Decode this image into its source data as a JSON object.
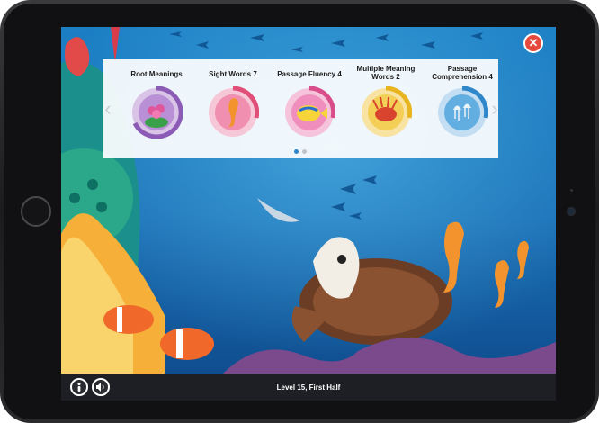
{
  "app": {
    "close_icon": "close-icon"
  },
  "levels": [
    {
      "title": "Root Meanings",
      "icon": "sea-anemone-icon",
      "ring_color": "#8b5bb5",
      "progress": 0.45,
      "bg": "#b98fd6"
    },
    {
      "title": "Sight Words 7",
      "icon": "seahorse-icon",
      "ring_color": "#e04f78",
      "progress": 0.3,
      "bg": "#f08fb0"
    },
    {
      "title": "Passage Fluency 4",
      "icon": "tropical-fish-icon",
      "ring_color": "#d84d8a",
      "progress": 0.3,
      "bg": "#f08fbd"
    },
    {
      "title": "Multiple Meaning Words 2",
      "icon": "lionfish-icon",
      "ring_color": "#e8b420",
      "progress": 0.3,
      "bg": "#f4cf57"
    },
    {
      "title": "Passage Comprehension 4",
      "icon": "jellyfish-icon",
      "ring_color": "#2f86c9",
      "progress": 0.3,
      "bg": "#62aee0"
    }
  ],
  "pagination": {
    "active_color": "#2f86c9",
    "inactive_color": "#bfc4c9"
  },
  "footer": {
    "level_label": "Level 15, First Half",
    "info_icon": "info-icon",
    "sound_icon": "speaker-icon"
  }
}
